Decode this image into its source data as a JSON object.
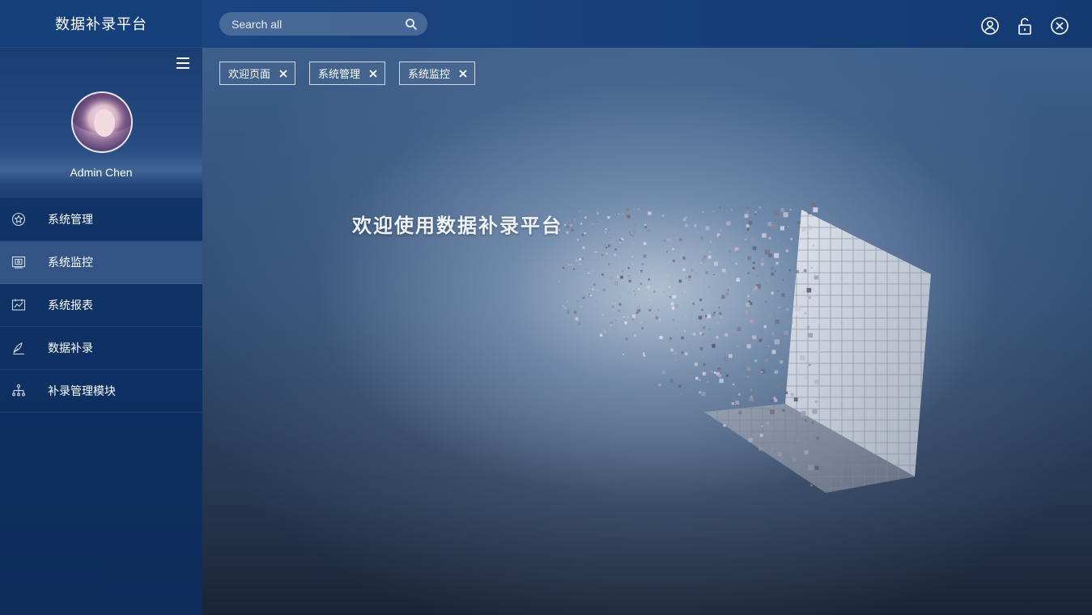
{
  "app": {
    "title": "数据补录平台"
  },
  "user": {
    "name": "Admin Chen"
  },
  "search": {
    "placeholder": "Search all"
  },
  "sidebar": {
    "items": [
      {
        "label": "系统管理",
        "icon": "star-circle-icon",
        "active": false
      },
      {
        "label": "系统监控",
        "icon": "monitor-icon",
        "active": true
      },
      {
        "label": "系统报表",
        "icon": "chart-icon",
        "active": false
      },
      {
        "label": "数据补录",
        "icon": "pen-icon",
        "active": false
      },
      {
        "label": "补录管理模块",
        "icon": "hierarchy-icon",
        "active": false
      }
    ]
  },
  "tabs": [
    {
      "label": "欢迎页面"
    },
    {
      "label": "系统管理"
    },
    {
      "label": "系统监控"
    }
  ],
  "main": {
    "welcome_text": "欢迎使用数据补录平台"
  },
  "header": {
    "icons": [
      "user-icon",
      "unlock-icon",
      "close-circle-icon"
    ]
  },
  "colors": {
    "sidebar": "#0f3265",
    "topbar": "#1b4580",
    "active_item": "#4a6a98"
  }
}
